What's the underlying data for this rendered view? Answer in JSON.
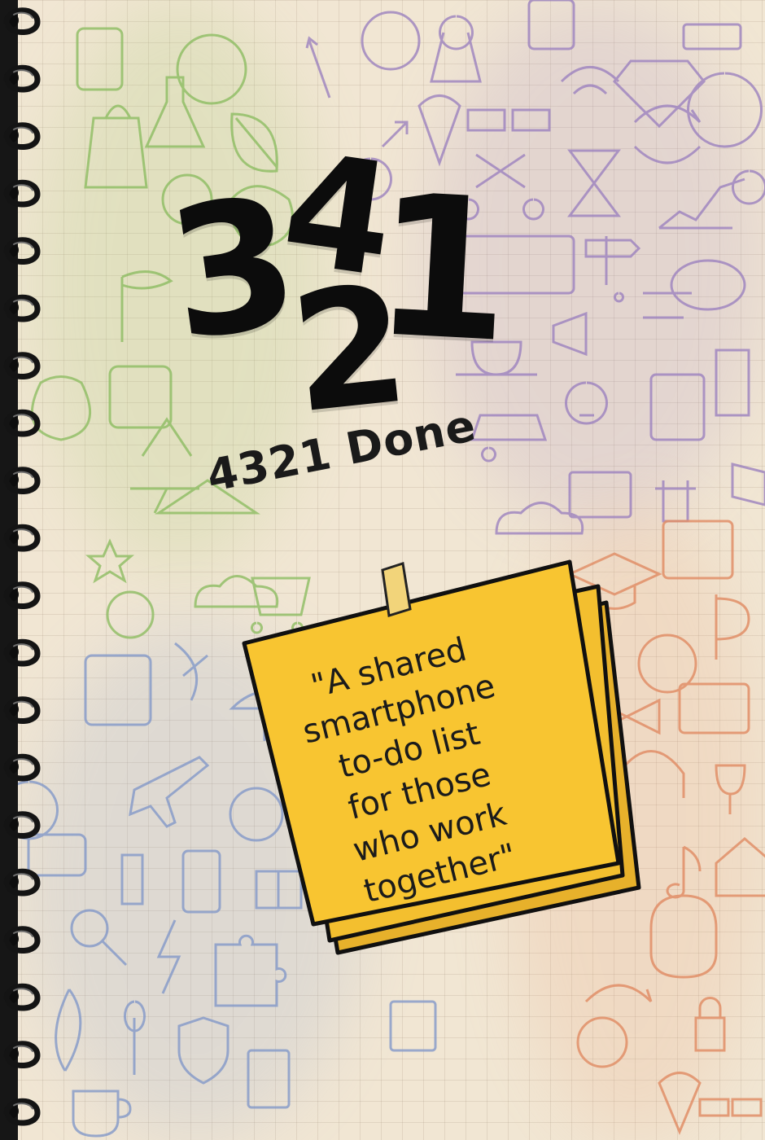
{
  "logo": {
    "digits": [
      "3",
      "4",
      "2",
      "1"
    ]
  },
  "app_name": "4321 Done",
  "tagline": {
    "lines": [
      "\"A shared",
      "smartphone",
      "to-do list",
      "for those",
      "who work",
      "together\""
    ]
  },
  "colors": {
    "page": "#f1e6d3",
    "sticky_front": "#f8c531",
    "sticky_back": "#eab626",
    "tape": "#f2d47a",
    "spine": "#161616",
    "doodle_green": "#9bc76a",
    "doodle_purple": "#a58ac2",
    "doodle_blue": "#8da3cf",
    "doodle_orange": "#e9a27c"
  }
}
